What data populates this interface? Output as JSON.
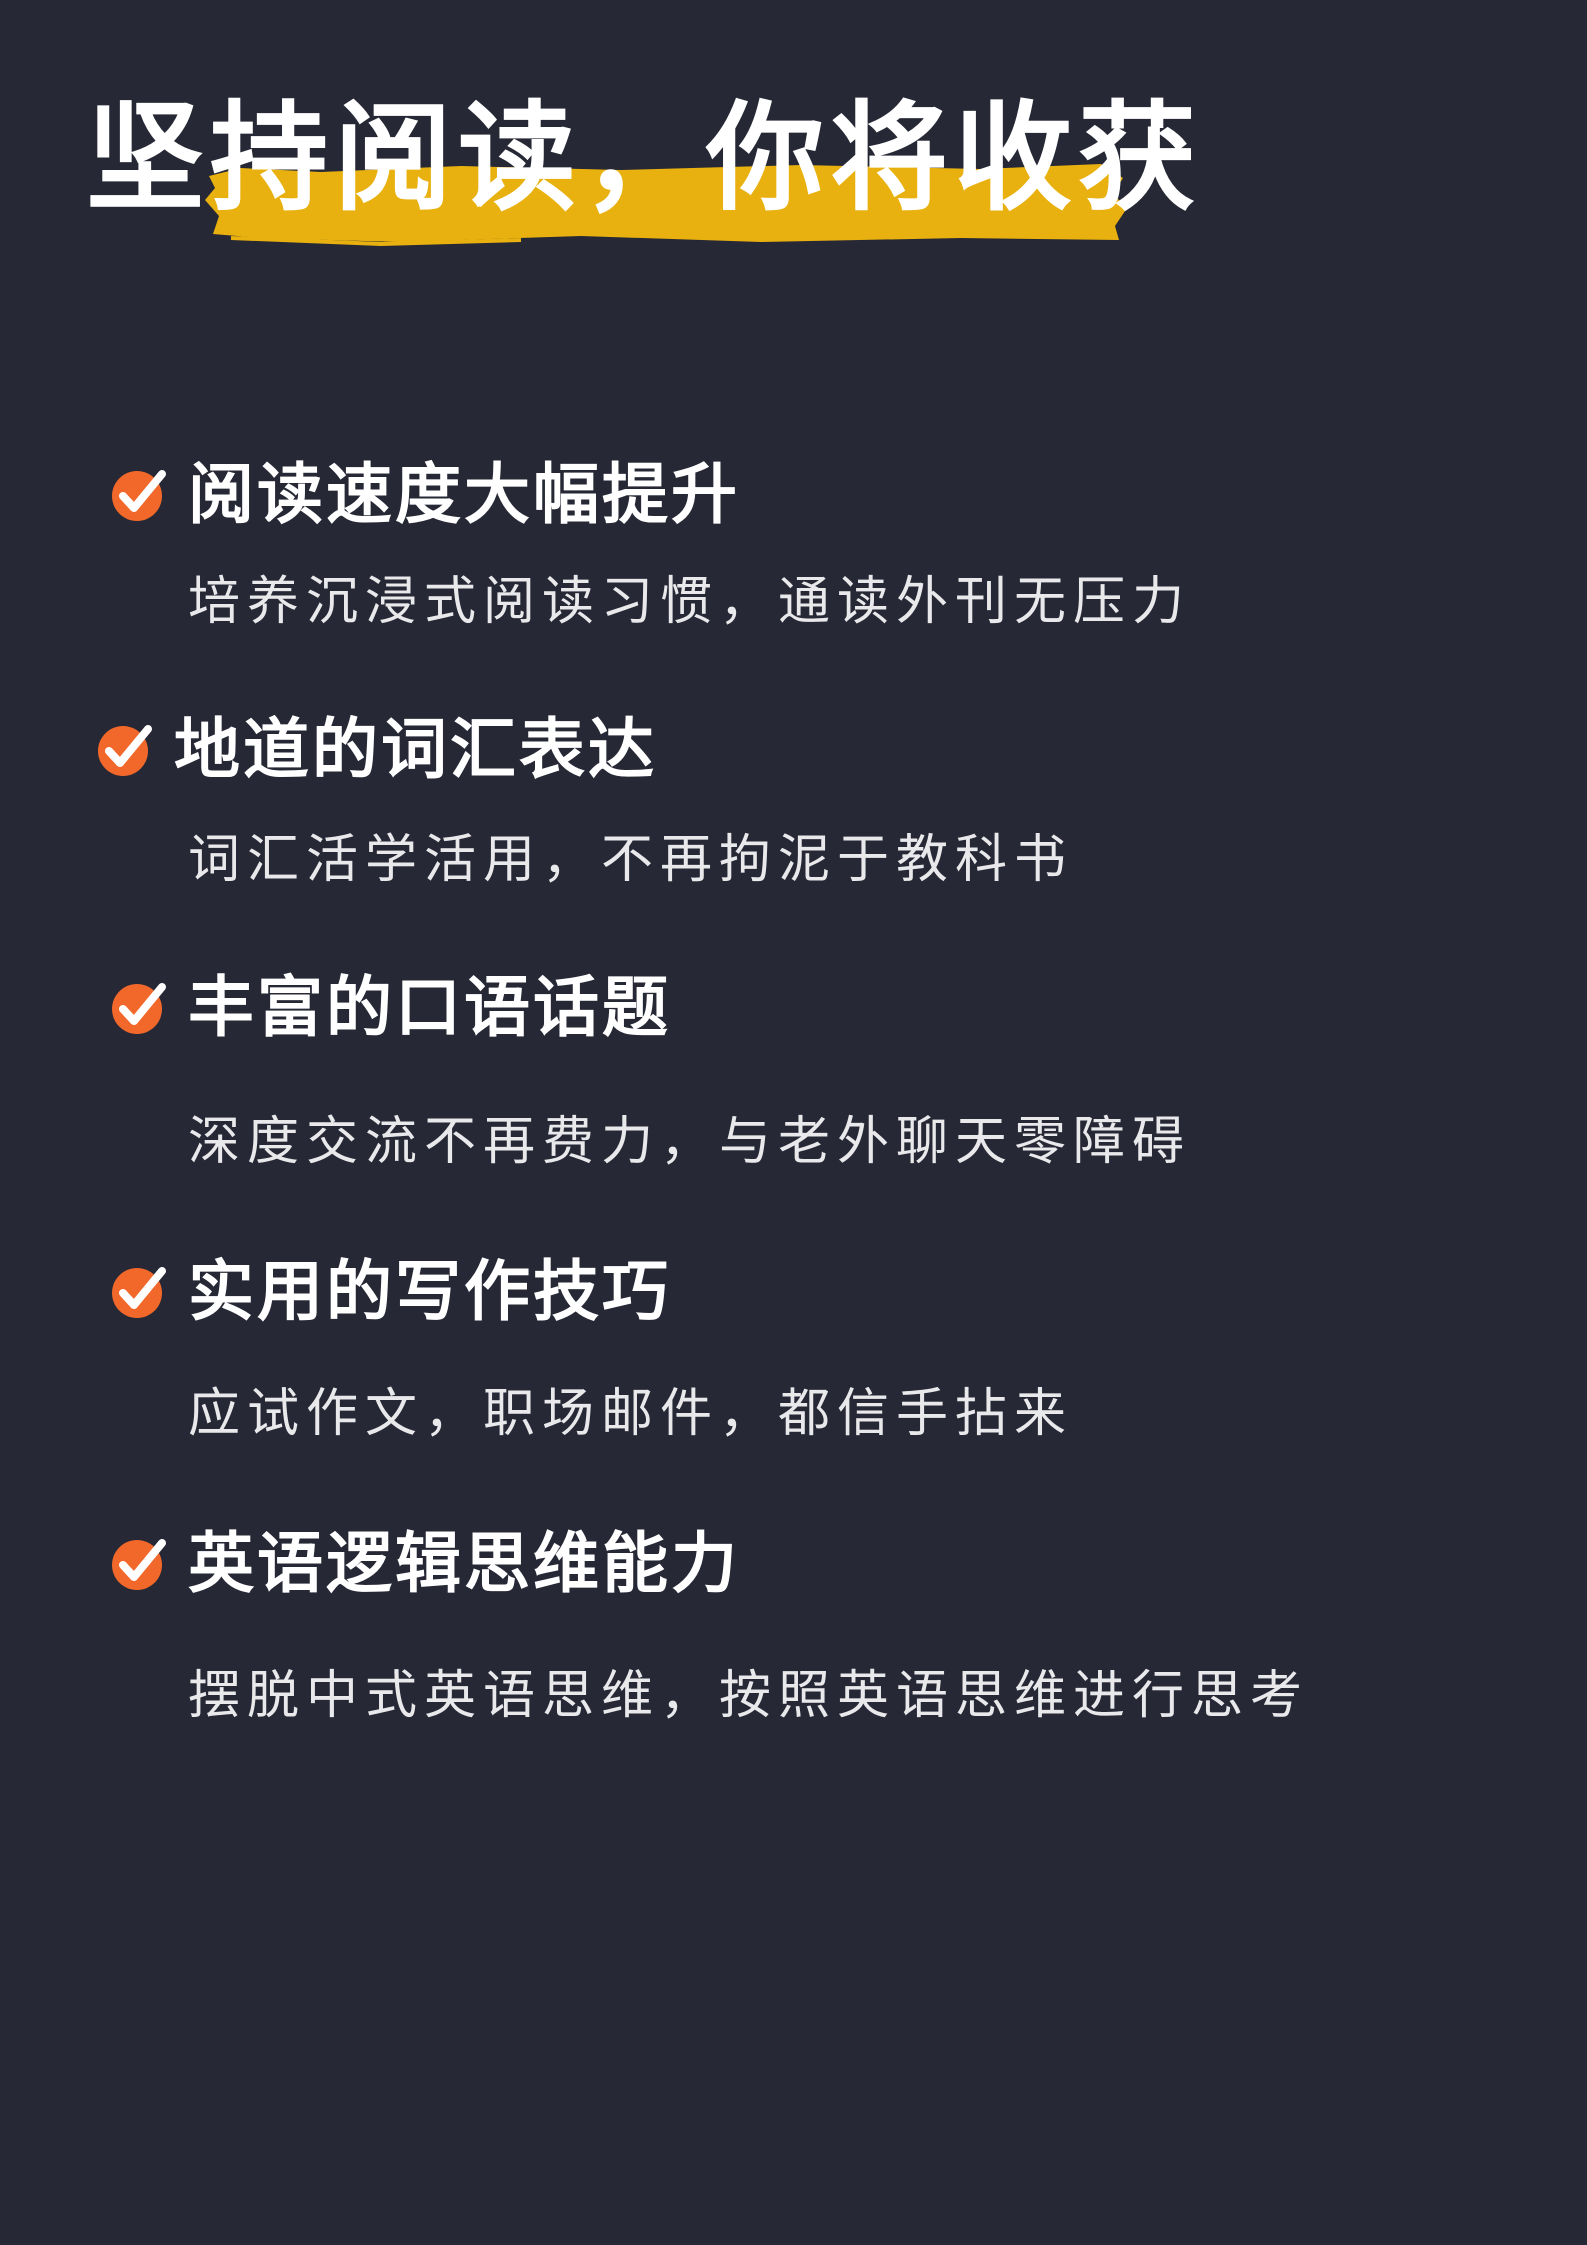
{
  "headline": "坚持阅读，你将收获",
  "colors": {
    "background": "#262835",
    "highlight": "#E8B10F",
    "check": "#F1682A",
    "text": "#FFFFFF"
  },
  "benefits": [
    {
      "icon": "check-badge-icon",
      "title": "阅读速度大幅提升",
      "description": "培养沉浸式阅读习惯，通读外刊无压力"
    },
    {
      "icon": "check-badge-icon",
      "title": "地道的词汇表达",
      "description": "词汇活学活用，不再拘泥于教科书"
    },
    {
      "icon": "check-badge-icon",
      "title": "丰富的口语话题",
      "description": "深度交流不再费力，与老外聊天零障碍"
    },
    {
      "icon": "check-badge-icon",
      "title": "实用的写作技巧",
      "description": "应试作文，职场邮件，都信手拈来"
    },
    {
      "icon": "check-badge-icon",
      "title": "英语逻辑思维能力",
      "description": "摆脱中式英语思维，按照英语思维进行思考"
    }
  ]
}
